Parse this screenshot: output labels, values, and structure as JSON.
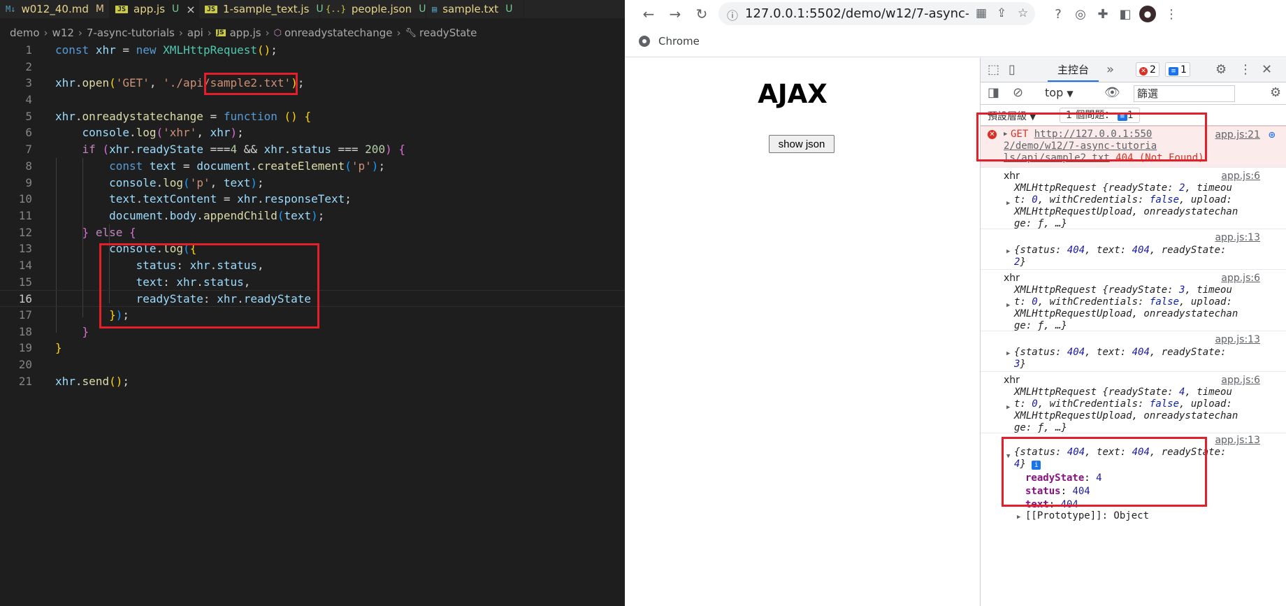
{
  "editor": {
    "tabs": [
      {
        "name": "w012_40.md",
        "status": "M"
      },
      {
        "name": "app.js",
        "status": "U",
        "active": true
      },
      {
        "name": "1-sample_text.js",
        "status": "U"
      },
      {
        "name": "people.json",
        "status": "U"
      },
      {
        "name": "sample.txt",
        "status": "U"
      }
    ],
    "close_glyph": "×",
    "breadcrumb": [
      "demo",
      "w12",
      "7-async-tutorials",
      "api",
      "app.js",
      "onreadystatechange",
      "readyState"
    ],
    "line_numbers": [
      "1",
      "2",
      "3",
      "4",
      "5",
      "6",
      "7",
      "8",
      "9",
      "10",
      "11",
      "12",
      "13",
      "14",
      "15",
      "16",
      "17",
      "18",
      "19",
      "20",
      "21"
    ],
    "current_line": "16"
  },
  "browser": {
    "url": "127.0.0.1:5502/demo/w12/7-async-tutorials/in...",
    "bookmark": "Chrome",
    "page_title": "AJAX",
    "button_label": "show json"
  },
  "devtools": {
    "console_tab": "主控台",
    "error_count": "2",
    "info_count": "1",
    "context": "top",
    "filter_placeholder": "篩選",
    "levels": "預設層級",
    "issues": "1 個問題：",
    "issues_count": "1",
    "error_message": {
      "method": "GET",
      "url_lines": [
        "http://127.0.0.1:550",
        "2/demo/w12/7-async-tutoria",
        "ls/api/sample2.txt"
      ],
      "status": "404 (Not Found)",
      "source": "app.js:21"
    },
    "log_xhr_label": "xhr",
    "log_source_6": "app.js:6",
    "log_source_13": "app.js:13",
    "prototype": "[[Prototype]]: Object",
    "expanded": {
      "readyState_key": "readyState",
      "readyState_val": "4",
      "status_key": "status",
      "status_val": "404",
      "text_key": "text",
      "text_val": "404"
    }
  }
}
